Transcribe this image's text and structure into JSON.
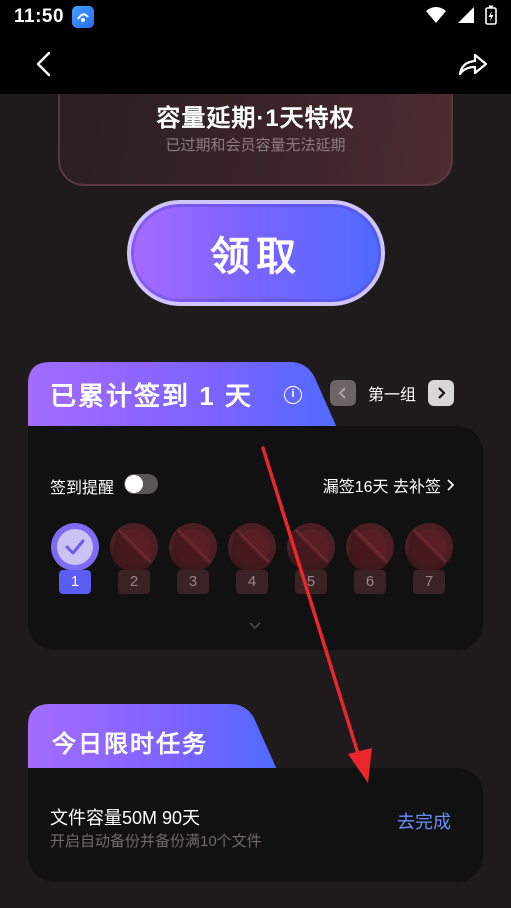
{
  "status_bar": {
    "time": "11:50"
  },
  "reward": {
    "title": "容量延期·1天特权",
    "subtitle": "已过期和会员容量无法延期",
    "claim_label": "领取"
  },
  "signin": {
    "title": "已累计签到 1 天",
    "info_icon": "info-icon",
    "group_label": "第一组",
    "reminder_label": "签到提醒",
    "reminder_on": false,
    "makeup_text": "漏签16天 去补签",
    "days": [
      {
        "label": "1",
        "checked": true
      },
      {
        "label": "2",
        "checked": false
      },
      {
        "label": "3",
        "checked": false
      },
      {
        "label": "4",
        "checked": false
      },
      {
        "label": "5",
        "checked": false
      },
      {
        "label": "6",
        "checked": false
      },
      {
        "label": "7",
        "checked": false
      }
    ]
  },
  "task": {
    "title": "今日限时任务",
    "name": "文件容量50M 90天",
    "desc": "开启自动备份并备份满10个文件",
    "action_label": "去完成"
  },
  "colors": {
    "accent_purple": "#7c63ff",
    "accent_blue": "#4f6bff",
    "action_blue": "#6b8cff",
    "annotation_red": "#e8282c"
  }
}
